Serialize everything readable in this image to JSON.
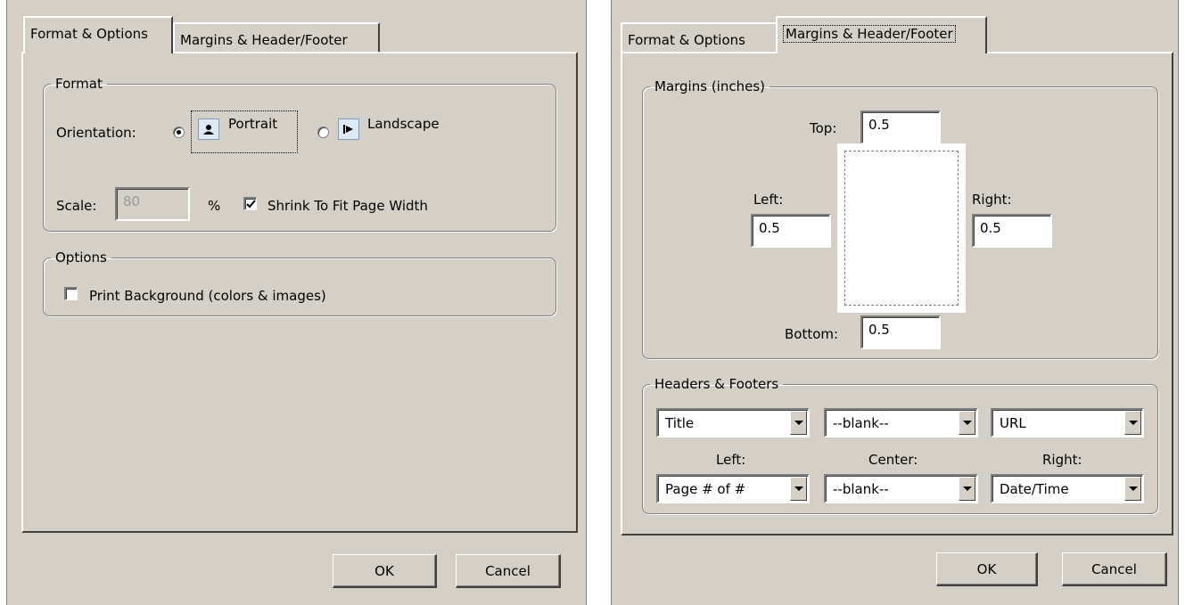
{
  "dialog1": {
    "tabs": [
      {
        "label": "Format & Options",
        "active": true
      },
      {
        "label": "Margins & Header/Footer",
        "active": false
      }
    ],
    "format_group": {
      "legend": "Format",
      "orientation_label": "Orientation:",
      "portrait_label": "Portrait",
      "landscape_label": "Landscape",
      "selected_orientation": "Portrait",
      "scale_label": "Scale:",
      "scale_value": "80",
      "percent_label": "%",
      "shrink_label": "Shrink To Fit Page Width",
      "shrink_checked": true
    },
    "options_group": {
      "legend": "Options",
      "print_bg_label": "Print Background (colors & images)",
      "print_bg_checked": false
    },
    "buttons": {
      "ok": "OK",
      "cancel": "Cancel"
    }
  },
  "dialog2": {
    "tabs": [
      {
        "label": "Format & Options",
        "active": false
      },
      {
        "label": "Margins & Header/Footer",
        "active": true
      }
    ],
    "margins_group": {
      "legend": "Margins (inches)",
      "top_label": "Top:",
      "top_value": "0.5",
      "left_label": "Left:",
      "left_value": "0.5",
      "right_label": "Right:",
      "right_value": "0.5",
      "bottom_label": "Bottom:",
      "bottom_value": "0.5"
    },
    "headers_group": {
      "legend": "Headers & Footers",
      "header_left": "Title",
      "header_center": "--blank--",
      "header_right": "URL",
      "left_label": "Left:",
      "center_label": "Center:",
      "right_label": "Right:",
      "footer_left": "Page # of #",
      "footer_center": "--blank--",
      "footer_right": "Date/Time"
    },
    "buttons": {
      "ok": "OK",
      "cancel": "Cancel"
    }
  },
  "icons": {
    "portrait": "portrait-page-icon",
    "landscape": "landscape-page-icon",
    "dropdown": "chevron-down-icon"
  },
  "colors": {
    "dialog_bg": "#d4d0c8",
    "field_bg": "#ffffff",
    "disabled_text": "#9a9a9a"
  }
}
